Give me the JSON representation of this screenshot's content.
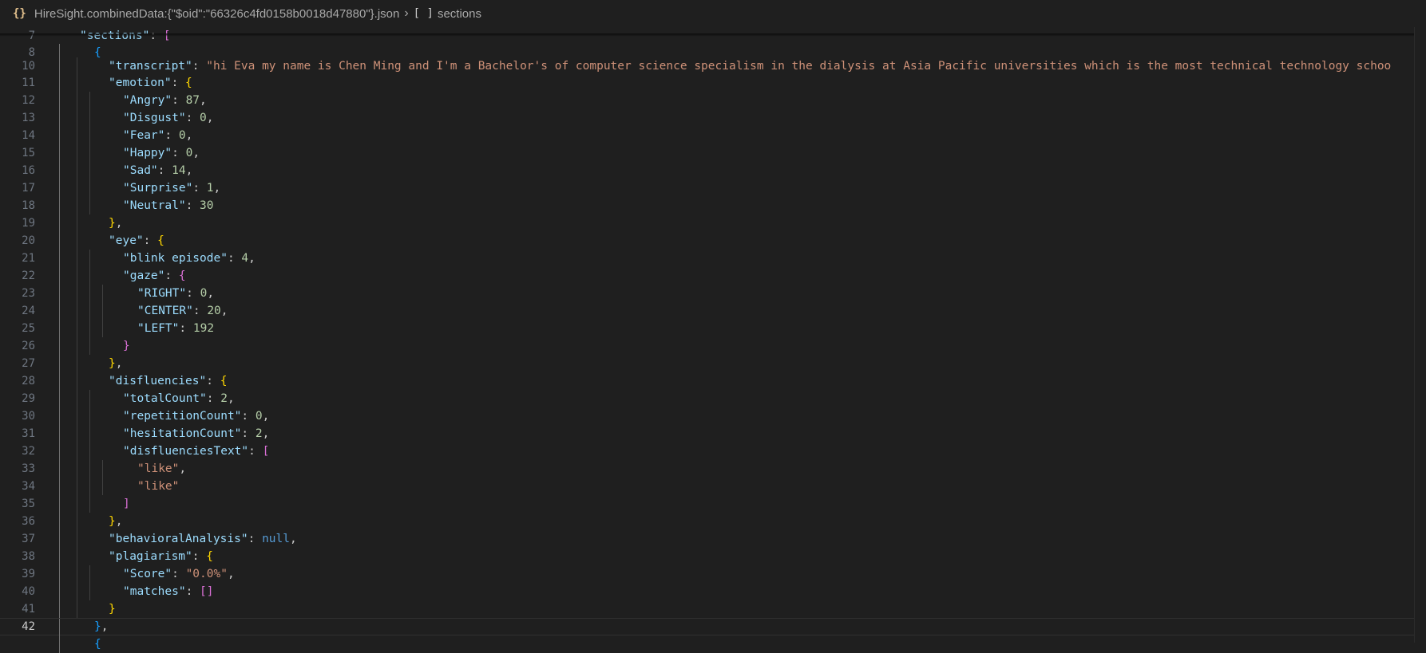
{
  "breadcrumb": {
    "file_icon": "{}",
    "file": "HireSight.combinedData:{\"$oid\":\"66326c4fd0158b0018d47880\"}.json",
    "array_icon": "[ ]",
    "section": "sections"
  },
  "lines": [
    {
      "num": "7",
      "tokens": [
        [
          "k",
          "\"sections\""
        ],
        [
          "p",
          ": "
        ],
        [
          "b2",
          "["
        ]
      ]
    },
    {
      "num": "8",
      "tokens": [
        [
          "b3",
          "{"
        ]
      ]
    },
    {
      "num": "10",
      "tokens": [
        [
          "k",
          "\"transcript\""
        ],
        [
          "p",
          ": "
        ],
        [
          "s",
          "\"hi Eva my name is Chen Ming and I'm a Bachelor's of computer science specialism in the dialysis at Asia Pacific universities which is the most technical technology schoo"
        ]
      ]
    },
    {
      "num": "11",
      "tokens": [
        [
          "k",
          "\"emotion\""
        ],
        [
          "p",
          ": "
        ],
        [
          "b1",
          "{"
        ]
      ]
    },
    {
      "num": "12",
      "tokens": [
        [
          "k",
          "\"Angry\""
        ],
        [
          "p",
          ": "
        ],
        [
          "n",
          "87"
        ],
        [
          "p",
          ","
        ]
      ]
    },
    {
      "num": "13",
      "tokens": [
        [
          "k",
          "\"Disgust\""
        ],
        [
          "p",
          ": "
        ],
        [
          "n",
          "0"
        ],
        [
          "p",
          ","
        ]
      ]
    },
    {
      "num": "14",
      "tokens": [
        [
          "k",
          "\"Fear\""
        ],
        [
          "p",
          ": "
        ],
        [
          "n",
          "0"
        ],
        [
          "p",
          ","
        ]
      ]
    },
    {
      "num": "15",
      "tokens": [
        [
          "k",
          "\"Happy\""
        ],
        [
          "p",
          ": "
        ],
        [
          "n",
          "0"
        ],
        [
          "p",
          ","
        ]
      ]
    },
    {
      "num": "16",
      "tokens": [
        [
          "k",
          "\"Sad\""
        ],
        [
          "p",
          ": "
        ],
        [
          "n",
          "14"
        ],
        [
          "p",
          ","
        ]
      ]
    },
    {
      "num": "17",
      "tokens": [
        [
          "k",
          "\"Surprise\""
        ],
        [
          "p",
          ": "
        ],
        [
          "n",
          "1"
        ],
        [
          "p",
          ","
        ]
      ]
    },
    {
      "num": "18",
      "tokens": [
        [
          "k",
          "\"Neutral\""
        ],
        [
          "p",
          ": "
        ],
        [
          "n",
          "30"
        ]
      ]
    },
    {
      "num": "19",
      "tokens": [
        [
          "b1",
          "}"
        ],
        [
          "p",
          ","
        ]
      ]
    },
    {
      "num": "20",
      "tokens": [
        [
          "k",
          "\"eye\""
        ],
        [
          "p",
          ": "
        ],
        [
          "b1",
          "{"
        ]
      ]
    },
    {
      "num": "21",
      "tokens": [
        [
          "k",
          "\"blink episode\""
        ],
        [
          "p",
          ": "
        ],
        [
          "n",
          "4"
        ],
        [
          "p",
          ","
        ]
      ]
    },
    {
      "num": "22",
      "tokens": [
        [
          "k",
          "\"gaze\""
        ],
        [
          "p",
          ": "
        ],
        [
          "b2",
          "{"
        ]
      ]
    },
    {
      "num": "23",
      "tokens": [
        [
          "k",
          "\"RIGHT\""
        ],
        [
          "p",
          ": "
        ],
        [
          "n",
          "0"
        ],
        [
          "p",
          ","
        ]
      ]
    },
    {
      "num": "24",
      "tokens": [
        [
          "k",
          "\"CENTER\""
        ],
        [
          "p",
          ": "
        ],
        [
          "n",
          "20"
        ],
        [
          "p",
          ","
        ]
      ]
    },
    {
      "num": "25",
      "tokens": [
        [
          "k",
          "\"LEFT\""
        ],
        [
          "p",
          ": "
        ],
        [
          "n",
          "192"
        ]
      ]
    },
    {
      "num": "26",
      "tokens": [
        [
          "b2",
          "}"
        ]
      ]
    },
    {
      "num": "27",
      "tokens": [
        [
          "b1",
          "}"
        ],
        [
          "p",
          ","
        ]
      ]
    },
    {
      "num": "28",
      "tokens": [
        [
          "k",
          "\"disfluencies\""
        ],
        [
          "p",
          ": "
        ],
        [
          "b1",
          "{"
        ]
      ]
    },
    {
      "num": "29",
      "tokens": [
        [
          "k",
          "\"totalCount\""
        ],
        [
          "p",
          ": "
        ],
        [
          "n",
          "2"
        ],
        [
          "p",
          ","
        ]
      ]
    },
    {
      "num": "30",
      "tokens": [
        [
          "k",
          "\"repetitionCount\""
        ],
        [
          "p",
          ": "
        ],
        [
          "n",
          "0"
        ],
        [
          "p",
          ","
        ]
      ]
    },
    {
      "num": "31",
      "tokens": [
        [
          "k",
          "\"hesitationCount\""
        ],
        [
          "p",
          ": "
        ],
        [
          "n",
          "2"
        ],
        [
          "p",
          ","
        ]
      ]
    },
    {
      "num": "32",
      "tokens": [
        [
          "k",
          "\"disfluenciesText\""
        ],
        [
          "p",
          ": "
        ],
        [
          "b2",
          "["
        ]
      ]
    },
    {
      "num": "33",
      "tokens": [
        [
          "s",
          "\"like\""
        ],
        [
          "p",
          ","
        ]
      ]
    },
    {
      "num": "34",
      "tokens": [
        [
          "s",
          "\"like\""
        ]
      ]
    },
    {
      "num": "35",
      "tokens": [
        [
          "b2",
          "]"
        ]
      ]
    },
    {
      "num": "36",
      "tokens": [
        [
          "b1",
          "}"
        ],
        [
          "p",
          ","
        ]
      ]
    },
    {
      "num": "37",
      "tokens": [
        [
          "k",
          "\"behavioralAnalysis\""
        ],
        [
          "p",
          ": "
        ],
        [
          "kw",
          "null"
        ],
        [
          "p",
          ","
        ]
      ]
    },
    {
      "num": "38",
      "tokens": [
        [
          "k",
          "\"plagiarism\""
        ],
        [
          "p",
          ": "
        ],
        [
          "b1",
          "{"
        ]
      ]
    },
    {
      "num": "39",
      "tokens": [
        [
          "k",
          "\"Score\""
        ],
        [
          "p",
          ": "
        ],
        [
          "s",
          "\"0.0%\""
        ],
        [
          "p",
          ","
        ]
      ]
    },
    {
      "num": "40",
      "tokens": [
        [
          "k",
          "\"matches\""
        ],
        [
          "p",
          ": "
        ],
        [
          "b2",
          "[]"
        ]
      ]
    },
    {
      "num": "41",
      "tokens": [
        [
          "b1",
          "}"
        ]
      ]
    },
    {
      "num": "42",
      "tokens": [
        [
          "b3",
          "}"
        ],
        [
          "p",
          ","
        ]
      ]
    },
    {
      "num": "",
      "tokens": [
        [
          "b3",
          "{"
        ]
      ]
    }
  ]
}
